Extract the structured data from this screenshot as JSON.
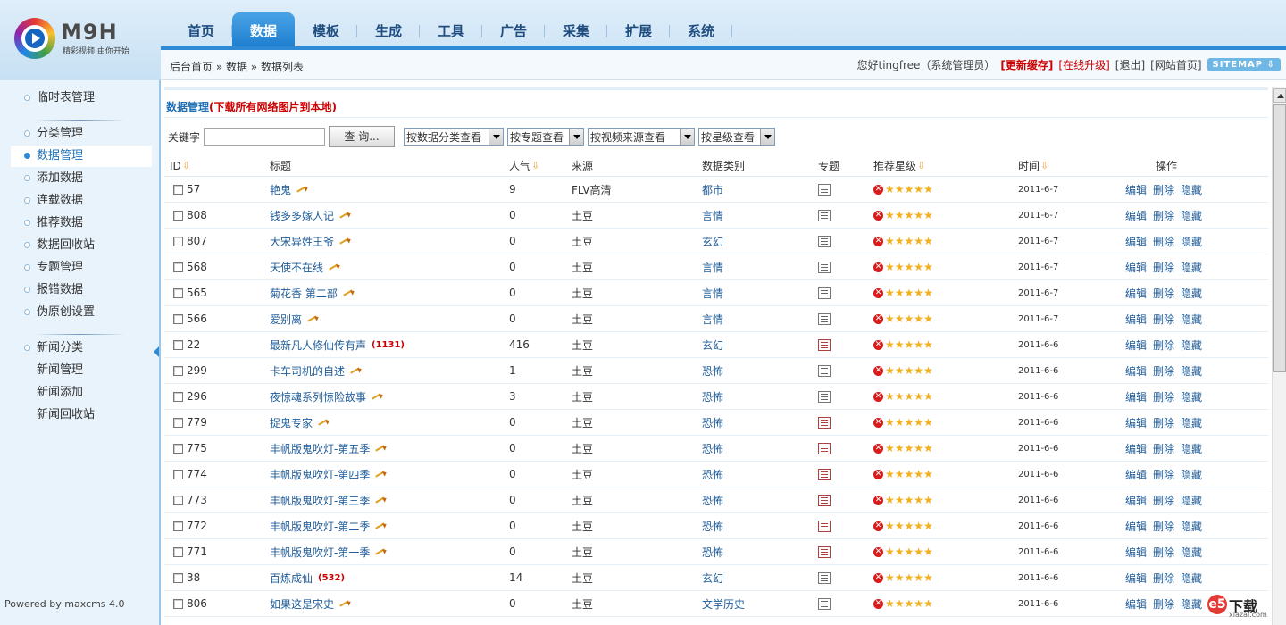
{
  "logo": {
    "brand": "M9H",
    "slogan": "精彩视频  由你开始"
  },
  "nav": {
    "items": [
      {
        "label": "首页"
      },
      {
        "label": "数据",
        "active": true
      },
      {
        "label": "模板"
      },
      {
        "label": "生成"
      },
      {
        "label": "工具"
      },
      {
        "label": "广告"
      },
      {
        "label": "采集"
      },
      {
        "label": "扩展"
      },
      {
        "label": "系统"
      }
    ]
  },
  "breadcrumb": "后台首页 » 数据 » 数据列表",
  "user": {
    "greeting": "您好tingfree（系统管理员）",
    "refresh_cache": "[更新缓存]",
    "online_upgrade": "[在线升级]",
    "logout": "[退出]",
    "site_home": "[网站首页]",
    "sitemap": "SITEMAP ⇩"
  },
  "sidebar": {
    "items": [
      {
        "label": "临时表管理"
      },
      {
        "label": "分类管理"
      },
      {
        "label": "数据管理",
        "active": true
      },
      {
        "label": "添加数据"
      },
      {
        "label": "连载数据"
      },
      {
        "label": "推荐数据"
      },
      {
        "label": "数据回收站"
      },
      {
        "label": "专题管理"
      },
      {
        "label": "报错数据"
      },
      {
        "label": "伪原创设置"
      },
      {
        "label": "新闻分类"
      },
      {
        "label": "新闻管理"
      },
      {
        "label": "新闻添加"
      },
      {
        "label": "新闻回收站"
      }
    ],
    "powered": "Powered by maxcms 4.0"
  },
  "main": {
    "title": "数据管理",
    "title_link": "(下载所有网络图片到本地)",
    "keyword_label": "关键字",
    "keyword_value": "",
    "query_button": "查 询...",
    "filters": [
      "按数据分类查看",
      "按专题查看",
      "按视频来源查看",
      "按星级查看"
    ],
    "columns": {
      "id": "ID",
      "title": "标题",
      "popularity": "人气",
      "source": "来源",
      "category": "数据类别",
      "topic": "专题",
      "stars": "推荐星级",
      "time": "时间",
      "ops": "操作"
    },
    "ops": [
      "编辑",
      "删除",
      "隐藏"
    ],
    "rows": [
      {
        "id": "57",
        "title": "艳鬼",
        "hot": "",
        "pop": "9",
        "src": "FLV高清",
        "cat": "都市",
        "topic_red": false,
        "time": "2011-6-7"
      },
      {
        "id": "808",
        "title": "钱多多嫁人记",
        "hot": "",
        "pop": "0",
        "src": "土豆",
        "cat": "言情",
        "topic_red": false,
        "time": "2011-6-7"
      },
      {
        "id": "807",
        "title": "大宋异姓王爷",
        "hot": "",
        "pop": "0",
        "src": "土豆",
        "cat": "玄幻",
        "topic_red": false,
        "time": "2011-6-7"
      },
      {
        "id": "568",
        "title": "天使不在线",
        "hot": "",
        "pop": "0",
        "src": "土豆",
        "cat": "言情",
        "topic_red": false,
        "time": "2011-6-7"
      },
      {
        "id": "565",
        "title": "菊花香  第二部",
        "hot": "",
        "pop": "0",
        "src": "土豆",
        "cat": "言情",
        "topic_red": false,
        "time": "2011-6-7"
      },
      {
        "id": "566",
        "title": "爱别离",
        "hot": "",
        "pop": "0",
        "src": "土豆",
        "cat": "言情",
        "topic_red": false,
        "time": "2011-6-7"
      },
      {
        "id": "22",
        "title": "最新凡人修仙传有声",
        "hot": "(1131)",
        "pop": "416",
        "src": "土豆",
        "cat": "玄幻",
        "topic_red": true,
        "time": "2011-6-6"
      },
      {
        "id": "299",
        "title": "卡车司机的自述",
        "hot": "",
        "pop": "1",
        "src": "土豆",
        "cat": "恐怖",
        "topic_red": false,
        "time": "2011-6-6"
      },
      {
        "id": "296",
        "title": "夜惊魂系列惊险故事",
        "hot": "",
        "pop": "3",
        "src": "土豆",
        "cat": "恐怖",
        "topic_red": false,
        "time": "2011-6-6"
      },
      {
        "id": "779",
        "title": "捉鬼专家",
        "hot": "",
        "pop": "0",
        "src": "土豆",
        "cat": "恐怖",
        "topic_red": true,
        "time": "2011-6-6"
      },
      {
        "id": "775",
        "title": "丰帆版鬼吹灯-第五季",
        "hot": "",
        "pop": "0",
        "src": "土豆",
        "cat": "恐怖",
        "topic_red": true,
        "time": "2011-6-6"
      },
      {
        "id": "774",
        "title": "丰帆版鬼吹灯-第四季",
        "hot": "",
        "pop": "0",
        "src": "土豆",
        "cat": "恐怖",
        "topic_red": true,
        "time": "2011-6-6"
      },
      {
        "id": "773",
        "title": "丰帆版鬼吹灯-第三季",
        "hot": "",
        "pop": "0",
        "src": "土豆",
        "cat": "恐怖",
        "topic_red": true,
        "time": "2011-6-6"
      },
      {
        "id": "772",
        "title": "丰帆版鬼吹灯-第二季",
        "hot": "",
        "pop": "0",
        "src": "土豆",
        "cat": "恐怖",
        "topic_red": true,
        "time": "2011-6-6"
      },
      {
        "id": "771",
        "title": "丰帆版鬼吹灯-第一季",
        "hot": "",
        "pop": "0",
        "src": "土豆",
        "cat": "恐怖",
        "topic_red": true,
        "time": "2011-6-6"
      },
      {
        "id": "38",
        "title": "百炼成仙",
        "hot": "(532)",
        "pop": "14",
        "src": "土豆",
        "cat": "玄幻",
        "topic_red": false,
        "time": "2011-6-6"
      },
      {
        "id": "806",
        "title": "如果这是宋史",
        "hot": "",
        "pop": "0",
        "src": "土豆",
        "cat": "文学历史",
        "topic_red": false,
        "time": "2011-6-6"
      }
    ]
  },
  "watermark": {
    "mark": "e5",
    "text": "下载",
    "url": "xiazai.com"
  },
  "colors": {
    "accent": "#2f8ad6",
    "link": "#1f5c99",
    "alert": "#cc0000",
    "star": "#f2b01e"
  }
}
